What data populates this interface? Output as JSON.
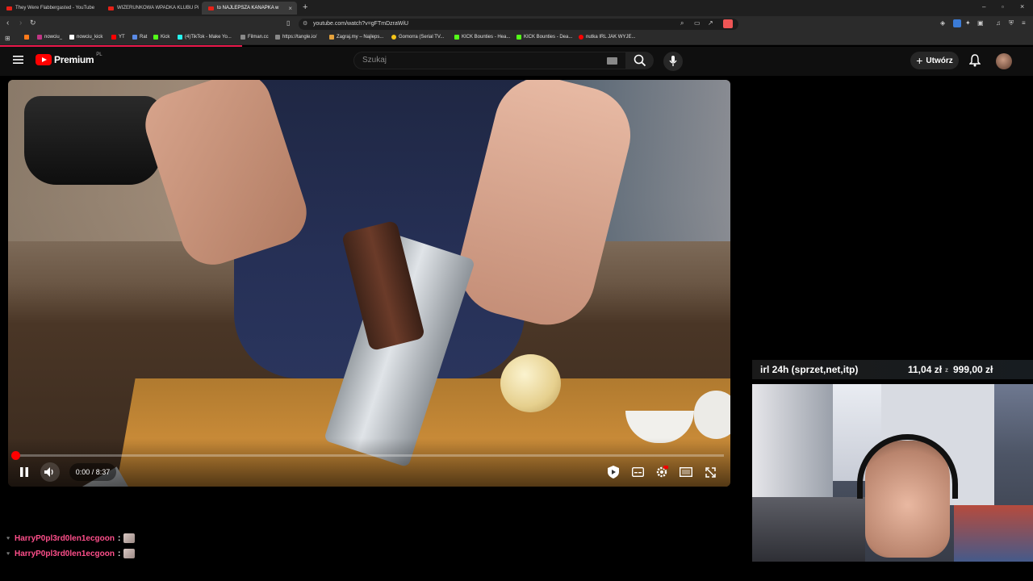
{
  "browser": {
    "tabs": [
      {
        "title": "They Were Flabbergasted - YouTube"
      },
      {
        "title": "WIZERUNKOWA WPADKA KLUBU Pi"
      },
      {
        "title": "to NAJLEPSZA KANAPKA w"
      }
    ],
    "url": "youtube.com/watch?v=gFTmDzraWiU",
    "bookmarks": [
      {
        "label": "nowciu_"
      },
      {
        "label": "nowciu_kick"
      },
      {
        "label": "YT"
      },
      {
        "label": "Rat"
      },
      {
        "label": "Kick"
      },
      {
        "label": "(4)TikTok - Make Yo..."
      },
      {
        "label": "Filman.cc"
      },
      {
        "label": "https://tangle.io/"
      },
      {
        "label": "Zagraj.my – Najleps..."
      },
      {
        "label": "Gomorra (Serial TV..."
      },
      {
        "label": "KICK Bounties - Hea..."
      },
      {
        "label": "KICK Bounties - Dea..."
      },
      {
        "label": "nutka IRL JAK WYJE..."
      }
    ]
  },
  "youtube": {
    "logo_text": "Premium",
    "logo_region": "PL",
    "search_placeholder": "Szukaj",
    "create_label": "Utwórz"
  },
  "player": {
    "time_current": "0:00",
    "time_separator": "/",
    "time_total": "8:37",
    "progress_fraction": 0.0
  },
  "stream_overlay": {
    "goal_label": "irl 24h (sprzet,net,itp)",
    "goal_amount": "11,04 zł",
    "goal_separator": "z",
    "goal_target": "999,00 zł"
  },
  "chat": [
    {
      "user": "HarryP0pl3rd0len1ecgoon",
      "colon": ":"
    },
    {
      "user": "HarryP0pl3rd0len1ecgoon",
      "colon": ":"
    }
  ],
  "colors": {
    "yt_red": "#ff0000",
    "chat_user": "#ff4f8b",
    "background": "#0f0f0f"
  }
}
